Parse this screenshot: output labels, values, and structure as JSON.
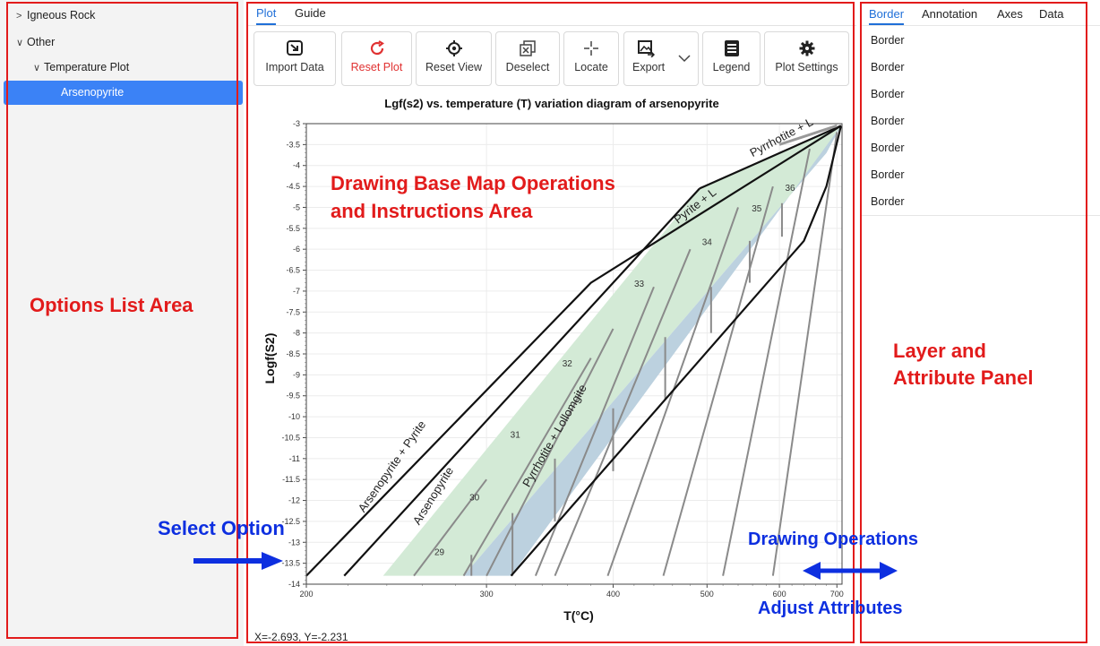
{
  "sidebar": {
    "items": [
      {
        "chevron": ">",
        "label": "Igneous Rock"
      },
      {
        "chevron": "∨",
        "label": "Other"
      },
      {
        "chevron": "∨",
        "label": "Temperature Plot"
      },
      {
        "chevron": "",
        "label": "Arsenopyrite"
      }
    ]
  },
  "main": {
    "tabs": [
      "Plot",
      "Guide"
    ],
    "toolbar": [
      {
        "label": "Import Data",
        "icon": "import-icon"
      },
      {
        "label": "Reset Plot",
        "icon": "refresh-icon",
        "color": "#e03131"
      },
      {
        "label": "Reset View",
        "icon": "target-icon"
      },
      {
        "label": "Deselect",
        "icon": "deselect-icon"
      },
      {
        "label": "Locate",
        "icon": "crosshair-icon"
      },
      {
        "label": "Export",
        "icon": "export-image-icon"
      },
      {
        "label": "Legend",
        "icon": "legend-icon"
      },
      {
        "label": "Plot Settings",
        "icon": "gear-icon"
      }
    ],
    "coordinates": "X=-2.693, Y=-2.231"
  },
  "right_panel": {
    "tabs": [
      "Border",
      "Annotation",
      "Axes",
      "Data"
    ],
    "items": [
      "Border",
      "Border",
      "Border",
      "Border",
      "Border",
      "Border",
      "Border"
    ]
  },
  "annotations": {
    "options_list": "Options List Area",
    "drawing_area_line1": "Drawing Base Map Operations",
    "drawing_area_line2": "and Instructions Area",
    "layer_panel_line1": "Layer and",
    "layer_panel_line2": "Attribute Panel",
    "select_option": "Select Option",
    "drawing_operations": "Drawing Operations",
    "adjust_attributes": "Adjust Attributes",
    "frame_color": "#e21b1b",
    "arrow_color": "#0d2fe0"
  },
  "chart_data": {
    "type": "line",
    "title": "Lgf(s2) vs. temperature (T) variation diagram of arsenopyrite",
    "xlabel": "T(°C)",
    "ylabel": "Logf(S2)",
    "x_scale": "reciprocal",
    "xlim": [
      200,
      710
    ],
    "ylim": [
      -14,
      -3
    ],
    "x_ticks": [
      200,
      300,
      400,
      500,
      600,
      700
    ],
    "y_ticks": [
      -3,
      -3.5,
      -4,
      -4.5,
      -5,
      -5.5,
      -6,
      -6.5,
      -7,
      -7.5,
      -8,
      -8.5,
      -9,
      -9.5,
      -10,
      -10.5,
      -11,
      -11.5,
      -12,
      -12.5,
      -13,
      -13.5,
      -14
    ],
    "grid": true,
    "series": [
      {
        "name": "Arsenopyrite + Pyrite",
        "x": [
          200,
          380,
          708
        ],
        "y": [
          -13.8,
          -6.8,
          -3.05
        ]
      },
      {
        "name": "Arsenopyrite",
        "x": [
          218,
          491
        ],
        "y": [
          -13.8,
          -4.55
        ]
      },
      {
        "name": "Pyrite + L",
        "x": [
          491,
          708
        ],
        "y": [
          -4.55,
          -3.05
        ]
      },
      {
        "name": "Pyrrhotite + L",
        "x": [
          600,
          700
        ],
        "y": [
          -3.5,
          -3.05
        ]
      },
      {
        "name": "Pyrrhotite + Lollomgite",
        "x": [
          317,
          640,
          680,
          708
        ],
        "y": [
          -13.8,
          -5.8,
          -4.5,
          -3.05
        ]
      }
    ],
    "regions": [
      {
        "fill": "#d3ead6",
        "boundary_x": [
          238,
          491,
          708,
          680,
          285
        ],
        "boundary_y": [
          -13.8,
          -4.55,
          -3.05,
          -3.7,
          -13.8
        ]
      },
      {
        "fill": "#bcd1df",
        "boundary_x": [
          285,
          680,
          708,
          317
        ],
        "boundary_y": [
          -13.8,
          -3.7,
          -3.05,
          -13.8
        ]
      }
    ],
    "isopleth_labels": [
      {
        "text": "29",
        "x": 270,
        "y": -13.3
      },
      {
        "text": "30",
        "x": 292,
        "y": -12
      },
      {
        "text": "31",
        "x": 320,
        "y": -10.5
      },
      {
        "text": "32",
        "x": 360,
        "y": -8.8
      },
      {
        "text": "33",
        "x": 425,
        "y": -6.9
      },
      {
        "text": "34",
        "x": 500,
        "y": -5.9
      },
      {
        "text": "35",
        "x": 566,
        "y": -5.1
      },
      {
        "text": "36",
        "x": 617,
        "y": -4.6
      }
    ],
    "line_labels": [
      "Arsenopyrite + Pyrite",
      "Arsenopyrite",
      "Pyrite + L",
      "Pyrrhotite + L",
      "Pyrrhotite + Lollomgite"
    ]
  }
}
